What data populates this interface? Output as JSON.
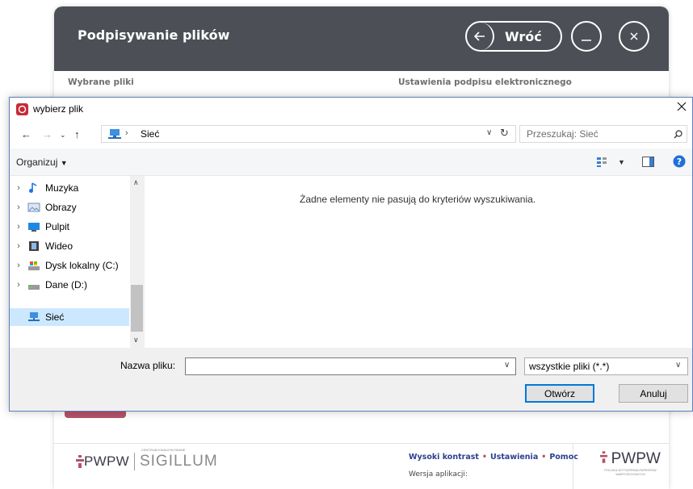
{
  "app": {
    "title": "Podpisywanie plików",
    "back_label": "Wróć",
    "left_section": "Wybrane pliki",
    "right_section": "Ustawienia podpisu elektronicznego",
    "footer": {
      "link_contrast": "Wysoki kontrast",
      "link_settings": "Ustawienia",
      "link_help": "Pomoc",
      "version_label": "Wersja aplikacji:",
      "logo_left_pwpw": "PWPW",
      "logo_left_sigillum": "SIGILLUM",
      "logo_left_small": "CENTRUM KWALIFIKOWANE",
      "logo_right_pwpw": "PWPW",
      "logo_right_small": "POLSKA WYTWÓRNIA PAPIERÓW WARTOŚCIOWYCH"
    }
  },
  "dialog": {
    "title": "wybierz plik",
    "address": "Sieć",
    "search_placeholder": "Przeszukaj: Sieć",
    "organize_label": "Organizuj",
    "empty_message": "Żadne elementy nie pasują do kryteriów wyszukiwania.",
    "tree": [
      {
        "label": "Muzyka",
        "icon": "music-icon",
        "color": "#1a73e8"
      },
      {
        "label": "Obrazy",
        "icon": "pictures-icon",
        "color": "#6b8fbf"
      },
      {
        "label": "Pulpit",
        "icon": "desktop-icon",
        "color": "#1e88e5"
      },
      {
        "label": "Wideo",
        "icon": "video-icon",
        "color": "#404040"
      },
      {
        "label": "Dysk lokalny (C:)",
        "icon": "drive-icon",
        "color": "#7a7a7a"
      },
      {
        "label": "Dane (D:)",
        "icon": "drive-icon",
        "color": "#7a7a7a"
      },
      {
        "label": "Sieć",
        "icon": "network-icon",
        "color": "#2f7fd1"
      }
    ],
    "filename_label": "Nazwa pliku:",
    "filename_value": "",
    "filetype_value": "wszystkie pliki (*.*)",
    "open_label": "Otwórz",
    "cancel_label": "Anuluj"
  },
  "colors": {
    "header": "#4c5056",
    "accent_pink": "#b4526a",
    "link_blue": "#2d3f8e",
    "selection": "#cce8ff"
  }
}
